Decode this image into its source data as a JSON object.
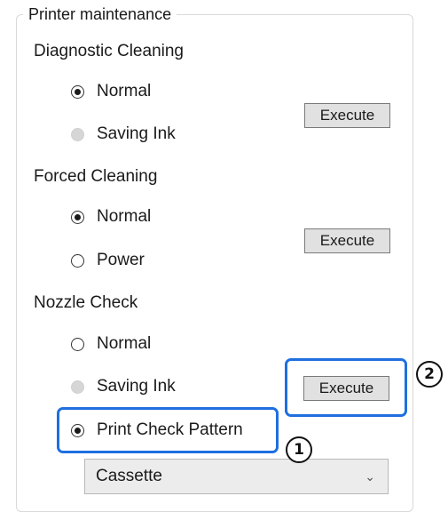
{
  "group": {
    "title": "Printer maintenance"
  },
  "diagnostic": {
    "label": "Diagnostic Cleaning",
    "options": [
      "Normal",
      "Saving Ink"
    ],
    "selected": "Normal",
    "execute_label": "Execute"
  },
  "forced": {
    "label": "Forced Cleaning",
    "options": [
      "Normal",
      "Power"
    ],
    "selected": "Normal",
    "execute_label": "Execute"
  },
  "nozzle": {
    "label": "Nozzle Check",
    "options": [
      "Normal",
      "Saving Ink",
      "Print Check Pattern"
    ],
    "selected": "Print Check Pattern",
    "execute_label": "Execute",
    "paper_source": {
      "value": "Cassette",
      "icon": "chevron-down-icon"
    }
  },
  "callouts": {
    "one": "1",
    "two": "2"
  },
  "colors": {
    "highlight": "#1f6fe0",
    "button_bg": "#e1e1e1"
  }
}
